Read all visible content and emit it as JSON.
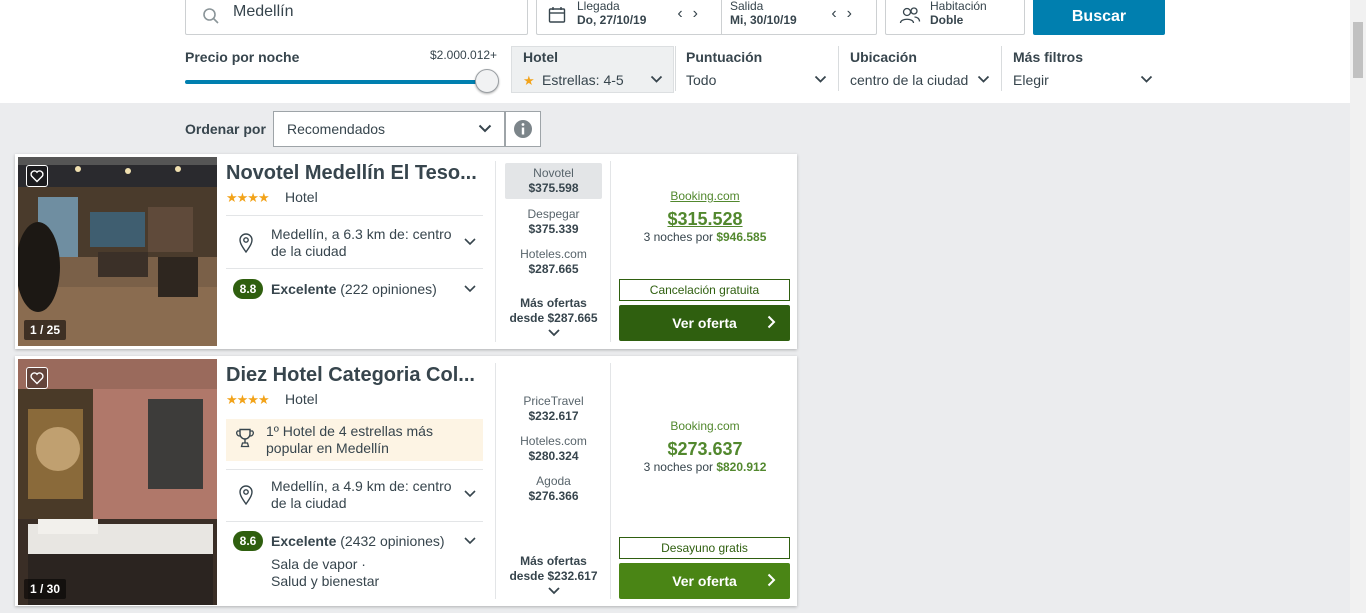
{
  "search": {
    "destination": "Medellín"
  },
  "dates": {
    "checkin_label": "Llegada",
    "checkin_value": "Do, 27/10/19",
    "checkout_label": "Salida",
    "checkout_value": "Mi, 30/10/19"
  },
  "room": {
    "label": "Habitación",
    "value": "Doble"
  },
  "search_button": "Buscar",
  "filters": {
    "price_label": "Precio por noche",
    "price_max": "$2.000.012+",
    "price_level_fraction": 1.0,
    "hotel_label": "Hotel",
    "hotel_value": "Estrellas: 4-5",
    "rating_label": "Puntuación",
    "rating_value": "Todo",
    "location_label": "Ubicación",
    "location_value": "centro de la ciudad",
    "more_label": "Más filtros",
    "more_value": "Elegir"
  },
  "sort": {
    "label": "Ordenar por",
    "value": "Recomendados"
  },
  "hotels": [
    {
      "name": "Novotel Medellín El Teso...",
      "stars": "★★★★",
      "type": "Hotel",
      "location_line1": "Medellín, a 6.3 km de: centro",
      "location_line2": "de la ciudad",
      "rating": "8.8",
      "rating_word": "Excelente",
      "reviews": "(222 opiniones)",
      "photo_counter": "1 / 25",
      "providers": [
        {
          "name": "Novotel",
          "price": "$375.598"
        },
        {
          "name": "Despegar",
          "price": "$375.339"
        },
        {
          "name": "Hoteles.com",
          "price": "$287.665"
        }
      ],
      "more_offers_1": "Más ofertas",
      "more_offers_2": "desde $287.665",
      "best_site": "Booking.com",
      "best_price": "$315.528",
      "nights_text": "3 noches por ",
      "nights_total": "$946.585",
      "perk": "Cancelación gratuita",
      "cta": "Ver oferta"
    },
    {
      "name": "Diez Hotel Categoria Col...",
      "stars": "★★★★",
      "type": "Hotel",
      "popular_line1": "1º Hotel de 4 estrellas más",
      "popular_line2": "popular en Medellín",
      "location_line1": "Medellín, a 4.9 km de: centro",
      "location_line2": "de la ciudad",
      "rating": "8.6",
      "rating_word": "Excelente",
      "reviews": "(2432 opiniones)",
      "amenity_1": "Sala de vapor ·",
      "amenity_2": "Salud y bienestar",
      "photo_counter": "1 / 30",
      "providers": [
        {
          "name": "PriceTravel",
          "price": "$232.617"
        },
        {
          "name": "Hoteles.com",
          "price": "$280.324"
        },
        {
          "name": "Agoda",
          "price": "$276.366"
        }
      ],
      "more_offers_1": "Más ofertas",
      "more_offers_2": "desde $232.617",
      "best_site": "Booking.com",
      "best_price": "$273.637",
      "nights_text": "3 noches por ",
      "nights_total": "$820.912",
      "perk": "Desayuno gratis",
      "cta": "Ver oferta"
    }
  ],
  "colors": {
    "accent": "#007faf",
    "deal_green": "#2f5f0f",
    "price_green": "#52882e",
    "star": "#f2a31a"
  }
}
